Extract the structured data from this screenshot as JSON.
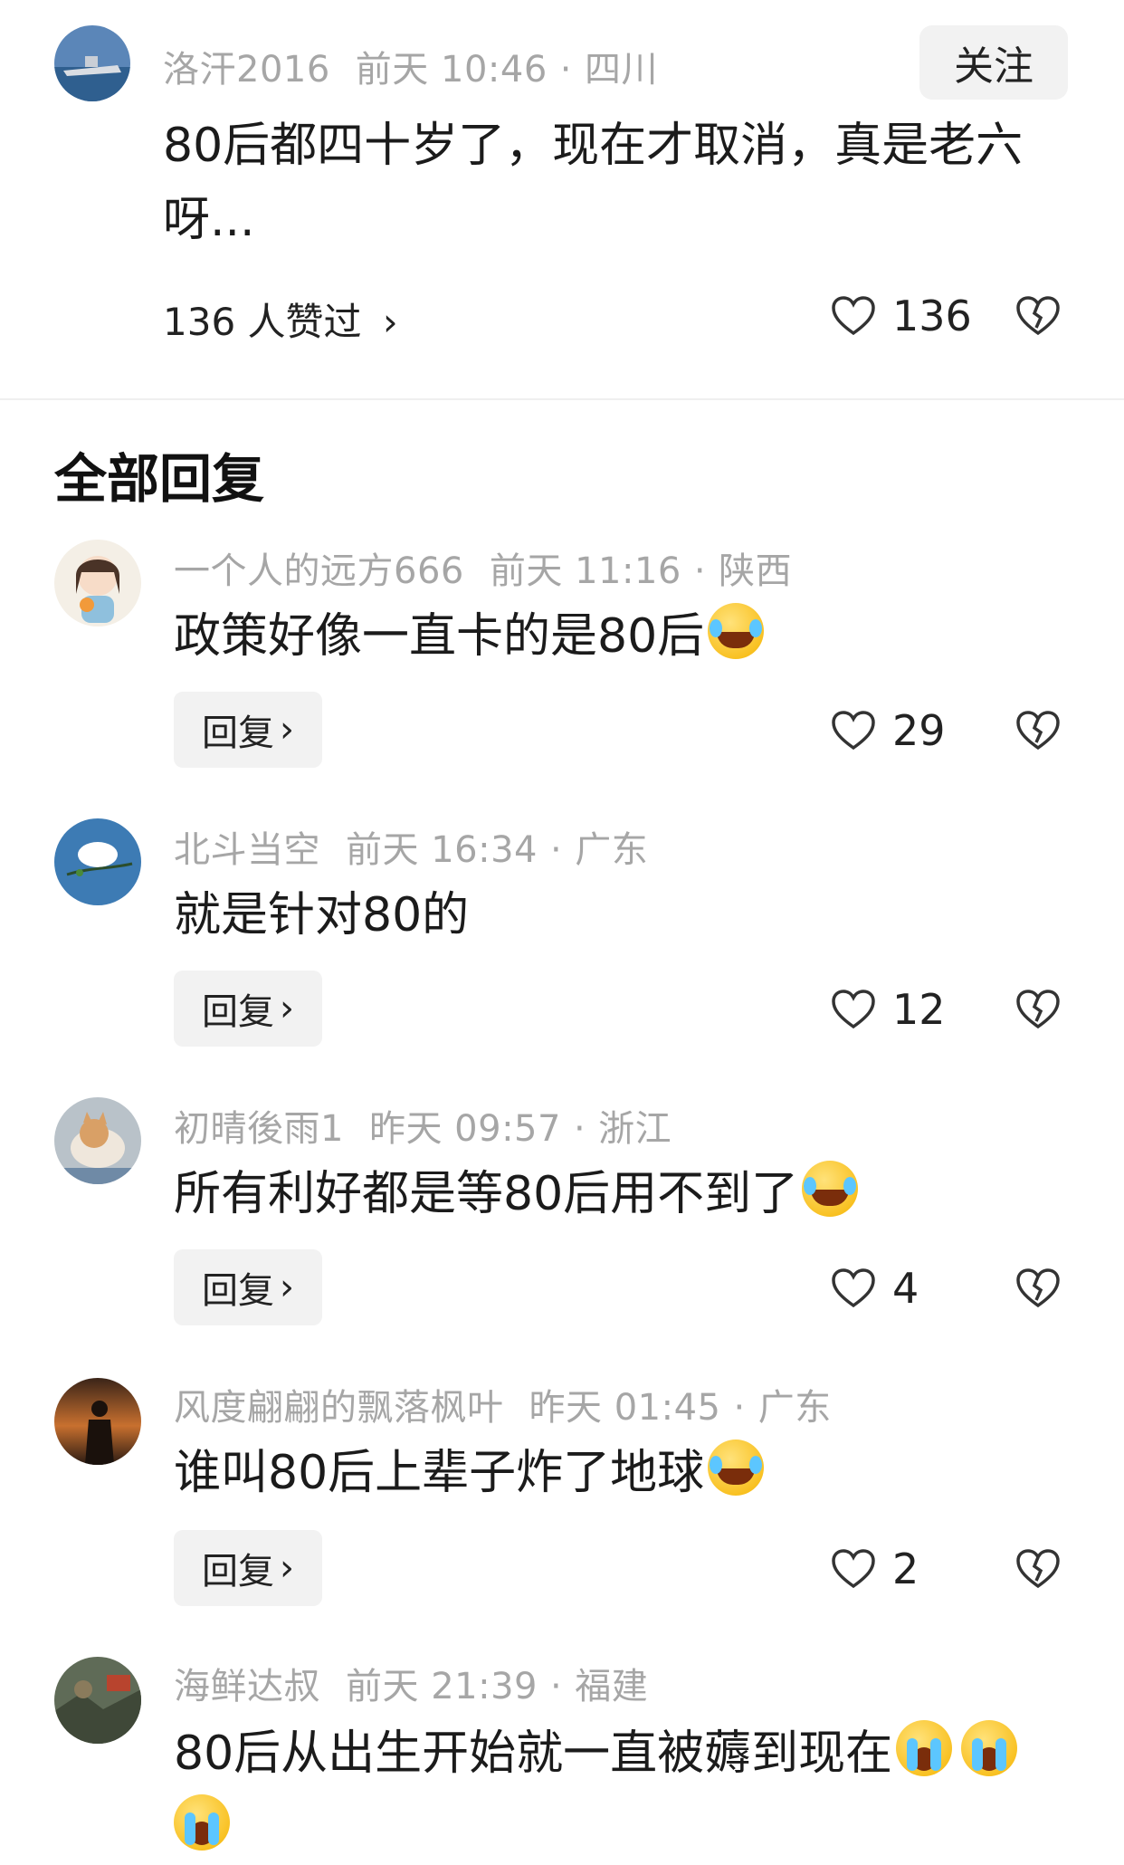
{
  "main_comment": {
    "username": "洛汗2016",
    "time": "前天 10:46",
    "location": "四川",
    "follow_label": "关注",
    "text_line1": "80后都四十岁了，现在才取消，真是老六",
    "text_line2": "呀...",
    "likers_text": "136 人赞过",
    "likers_arrow": "›",
    "like_count": "136"
  },
  "section_title": "全部回复",
  "reply_label": "回复",
  "reply_arrow": "›",
  "replies": [
    {
      "username": "一个人的远方666",
      "time": "前天 11:16",
      "location": "陕西",
      "text": "政策好像一直卡的是80后",
      "emoji": "laugh",
      "likes": "29"
    },
    {
      "username": "北斗当空",
      "time": "前天 16:34",
      "location": "广东",
      "text": "就是针对80的",
      "emoji": "",
      "likes": "12"
    },
    {
      "username": "初晴後雨1",
      "time": "昨天 09:57",
      "location": "浙江",
      "text": "所有利好都是等80后用不到了",
      "emoji": "laugh",
      "likes": "4"
    },
    {
      "username": "风度翩翩的飘落枫叶",
      "time": "昨天 01:45",
      "location": "广东",
      "text": "谁叫80后上辈子炸了地球",
      "emoji": "laugh",
      "likes": "2"
    },
    {
      "username": "海鲜达叔",
      "time": "前天 21:39",
      "location": "福建",
      "text": "80后从出生开始就一直被薅到现在",
      "emoji": "cry",
      "likes": ""
    }
  ],
  "colors": {
    "meta_gray": "#a6a6a6",
    "button_bg": "#f2f2f2",
    "text": "#1b1b1b"
  }
}
